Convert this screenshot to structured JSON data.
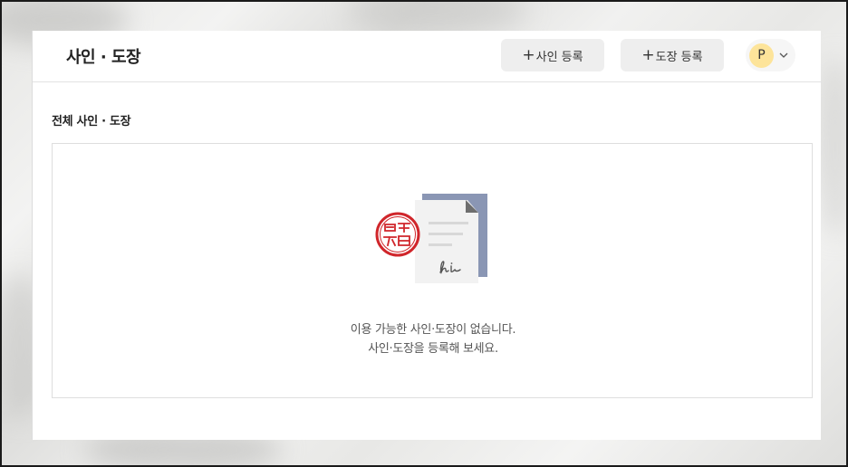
{
  "header": {
    "title": "사인 · 도장",
    "add_sign_label": "사인 등록",
    "add_stamp_label": "도장 등록",
    "plus_glyph": "+",
    "profile_initial": "P"
  },
  "section": {
    "title": "전체 사인 · 도장"
  },
  "empty_state": {
    "line1": "이용 가능한 사인·도장이 없습니다.",
    "line2": "사인·도장을 등록해 보세요."
  },
  "colors": {
    "accent_button_bg": "#eeeeee",
    "avatar_bg": "#fde49a",
    "stamp_red": "#d0262b",
    "doc_blue": "#8a96b4"
  }
}
